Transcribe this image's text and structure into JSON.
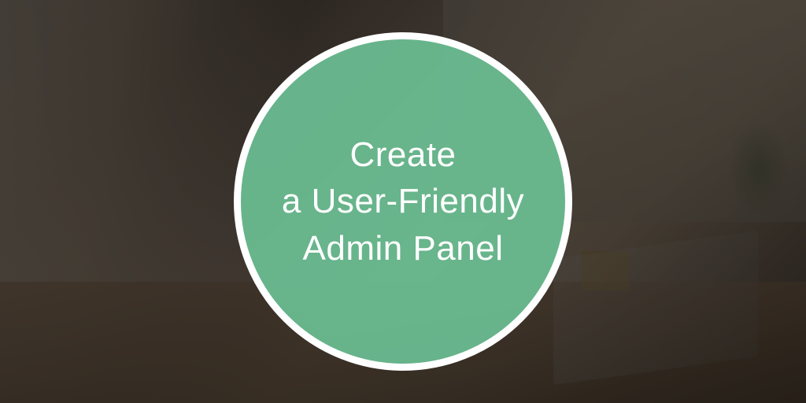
{
  "badge": {
    "line1": "Create",
    "line2": "a User-Friendly",
    "line3": "Admin Panel"
  },
  "colors": {
    "circle_fill": "rgba(107, 191, 148, 0.92)",
    "circle_border": "#ffffff",
    "text": "#ffffff"
  }
}
